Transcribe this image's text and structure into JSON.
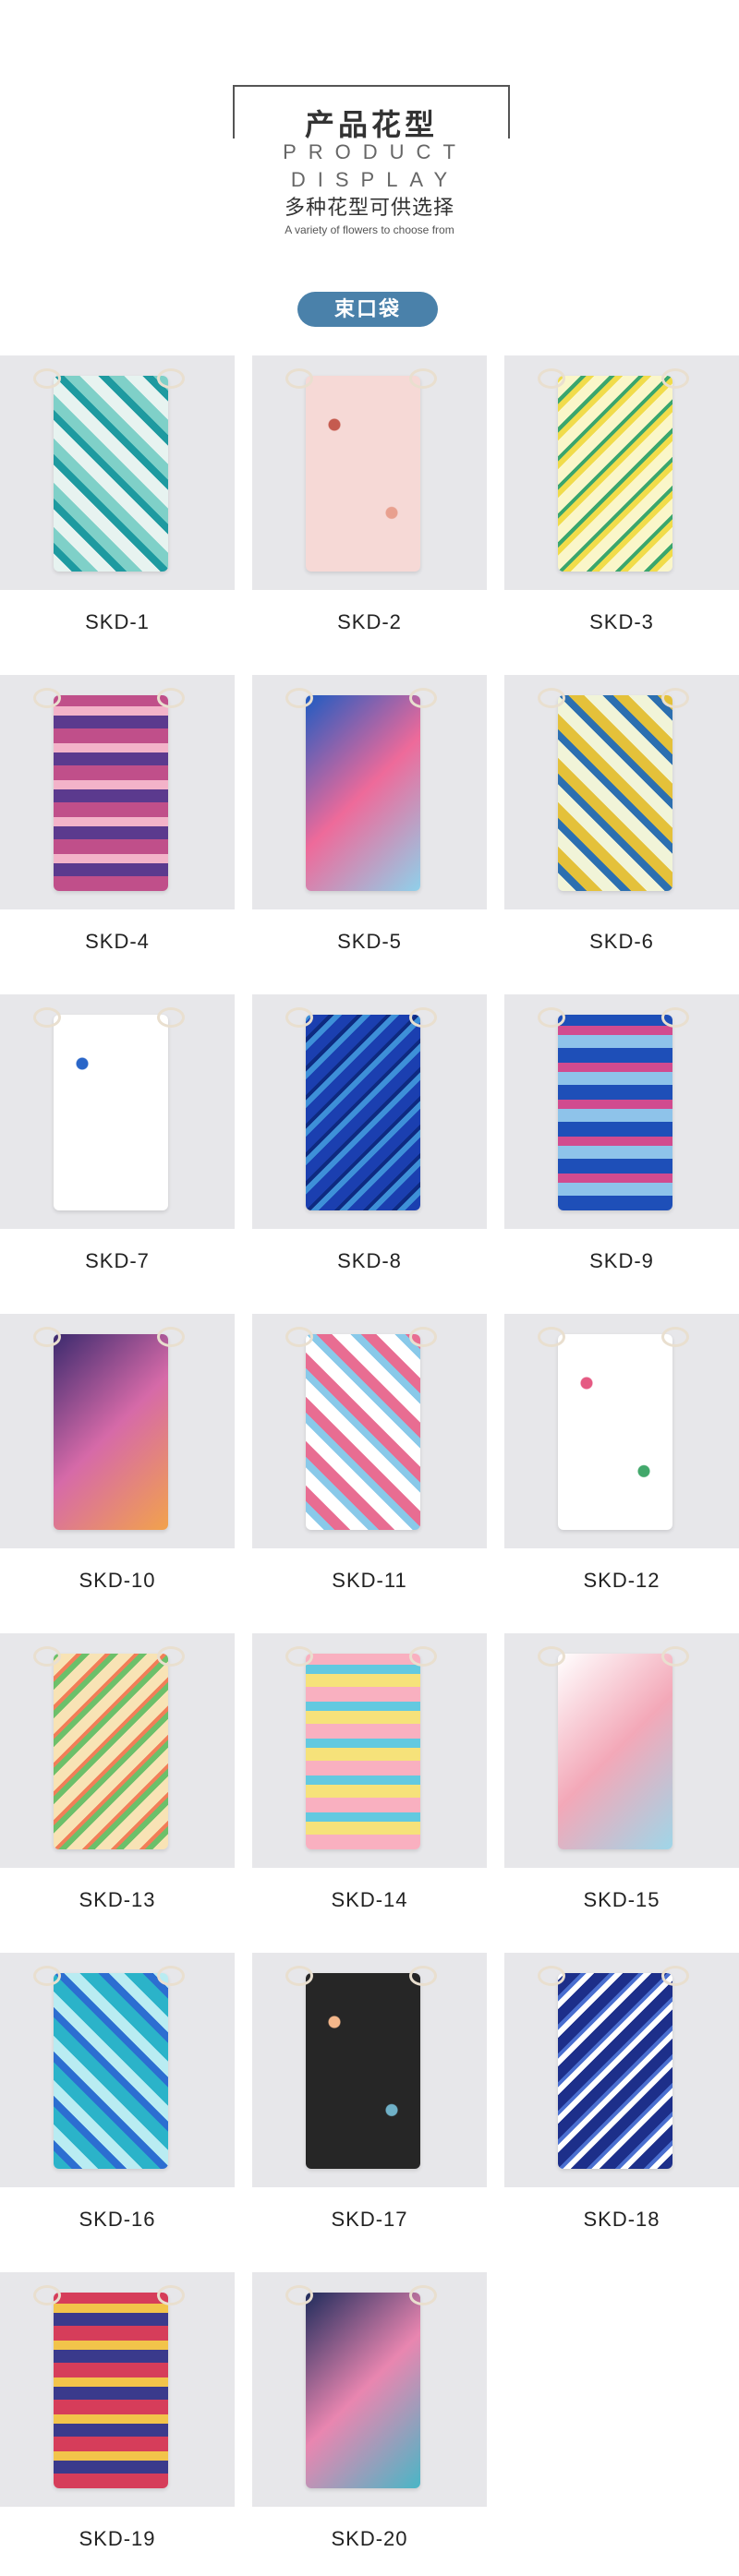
{
  "header": {
    "title_cn": "产品花型",
    "title_en": "PRODUCT DISPLAY",
    "subtitle_cn": "多种花型可供选择",
    "subtitle_en": "A variety of flowers to choose from"
  },
  "category": {
    "label": "束口袋"
  },
  "products": [
    {
      "code": "SKD-1",
      "pattern": "tropical-leaves-teal",
      "colors": [
        "#e7f3f0",
        "#1e9aa0",
        "#7fd0c8"
      ]
    },
    {
      "code": "SKD-2",
      "pattern": "rainbows-pink",
      "colors": [
        "#f6d9d6",
        "#c55b4f",
        "#e8a08f"
      ]
    },
    {
      "code": "SKD-3",
      "pattern": "pineapples-yellow",
      "colors": [
        "#faf6c9",
        "#f1dc4a",
        "#3aa66e"
      ]
    },
    {
      "code": "SKD-4",
      "pattern": "diamond-mosaic-purple",
      "colors": [
        "#c04f8a",
        "#5b3a8e",
        "#f3b3c9"
      ]
    },
    {
      "code": "SKD-5",
      "pattern": "blue-leaves-pink",
      "colors": [
        "#1f5bc2",
        "#ee6a9a",
        "#8fd0ea"
      ]
    },
    {
      "code": "SKD-6",
      "pattern": "parrots-pastel",
      "colors": [
        "#f1f4d8",
        "#2c6fb0",
        "#e4c13a"
      ]
    },
    {
      "code": "SKD-7",
      "pattern": "blue-stripes",
      "colors": [
        "#ffffff",
        "#2a66c8",
        "#ffffff"
      ]
    },
    {
      "code": "SKD-8",
      "pattern": "tie-dye-blue",
      "colors": [
        "#1b3fb0",
        "#3e90d8",
        "#0e2a80"
      ]
    },
    {
      "code": "SKD-9",
      "pattern": "mandala-blue",
      "colors": [
        "#1e4fb8",
        "#8ec3ea",
        "#d14b8f"
      ]
    },
    {
      "code": "SKD-10",
      "pattern": "summer-time-sunset",
      "colors": [
        "#3b2a6e",
        "#d66aa8",
        "#f2a24c"
      ]
    },
    {
      "code": "SKD-11",
      "pattern": "watermelon-slices",
      "colors": [
        "#ffffff",
        "#89c9e9",
        "#e86d92"
      ]
    },
    {
      "code": "SKD-12",
      "pattern": "watermelon-stripes",
      "colors": [
        "#ffffff",
        "#e55a83",
        "#42a86b"
      ]
    },
    {
      "code": "SKD-13",
      "pattern": "fruit-mix",
      "colors": [
        "#f8e3b5",
        "#6cc06a",
        "#f27e58"
      ]
    },
    {
      "code": "SKD-14",
      "pattern": "pineapple-gradient",
      "colors": [
        "#f9b0c0",
        "#f6e27a",
        "#63c9e0"
      ]
    },
    {
      "code": "SKD-15",
      "pattern": "pastel-waves",
      "colors": [
        "#ffffff",
        "#f3a8b8",
        "#9fd6e8"
      ]
    },
    {
      "code": "SKD-16",
      "pattern": "tropical-leaves-blue",
      "colors": [
        "#2bb3c9",
        "#2c6ed1",
        "#b9ecf2"
      ]
    },
    {
      "code": "SKD-17",
      "pattern": "bird-of-paradise-dark",
      "colors": [
        "#262626",
        "#f3b68a",
        "#6fb0c7"
      ]
    },
    {
      "code": "SKD-18",
      "pattern": "azulejo-tiles",
      "colors": [
        "#1d2f8a",
        "#ffffff",
        "#4a6fd0"
      ]
    },
    {
      "code": "SKD-19",
      "pattern": "floral-folk-red",
      "colors": [
        "#d63d5a",
        "#3a3a8c",
        "#f2c44a"
      ]
    },
    {
      "code": "SKD-20",
      "pattern": "banana-leaves-navy",
      "colors": [
        "#1f2c5c",
        "#e986b0",
        "#49b6c6"
      ]
    }
  ]
}
